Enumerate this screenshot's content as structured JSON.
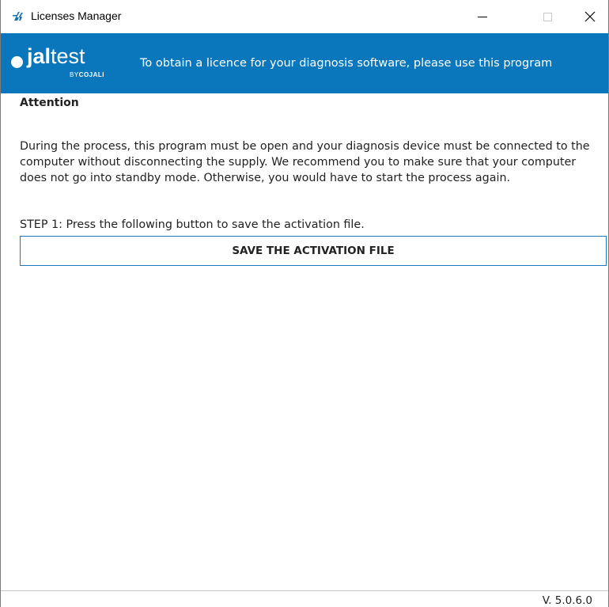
{
  "window": {
    "title": "Licenses Manager",
    "controls": {
      "minimize": "minimize",
      "maximize": "maximize",
      "close": "close"
    },
    "icon": "jaltest-app-icon"
  },
  "header": {
    "logo": {
      "wordmark_bold": "jal",
      "wordmark_light": "test",
      "by": "BY",
      "brand": "COJALI"
    },
    "message": "To obtain a licence for your diagnosis software, please use this program",
    "background_color": "#0a77bd"
  },
  "content": {
    "heading": "Attention",
    "paragraph": "During the process, this program must be open and your diagnosis device must be connected to the computer without disconnecting the supply. We recommend you to make sure that your computer does not go into standby mode. Otherwise, you would have to start the process again.",
    "step_label": "STEP 1: Press the following button to save the activation file.",
    "save_button_label": "SAVE THE ACTIVATION FILE",
    "accent_color": "#1c79c0"
  },
  "footer": {
    "version": "V. 5.0.6.0"
  }
}
